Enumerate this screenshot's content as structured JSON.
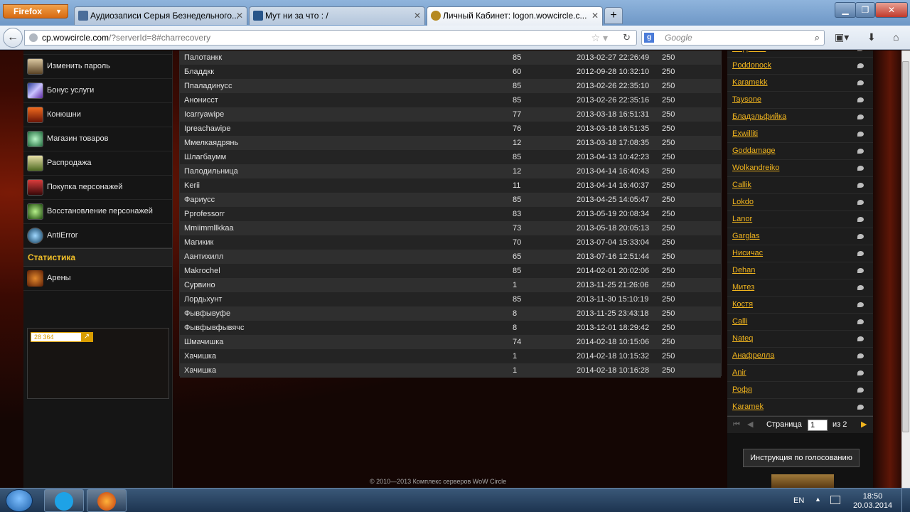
{
  "browser": {
    "menu_label": "Firefox",
    "tabs": [
      {
        "title": "Аудиозаписи Серыя Безнедельного..."
      },
      {
        "title": "Мут ни за что : /"
      },
      {
        "title": "Личный Кабинет: logon.wowcircle.c..."
      }
    ],
    "url_domain": "cp.wowcircle.com",
    "url_path": "/?serverId=8#charrecovery",
    "search_placeholder": "Google"
  },
  "sidebar": {
    "items": [
      {
        "label": "Изменить пароль"
      },
      {
        "label": "Бонус услуги"
      },
      {
        "label": "Конюшни"
      },
      {
        "label": "Магазин товаров"
      },
      {
        "label": "Распродажа"
      },
      {
        "label": "Покупка персонажей"
      },
      {
        "label": "Восстановление персонажей"
      },
      {
        "label": "AntiError"
      }
    ],
    "stats_header": "Статистика",
    "stats_items": [
      {
        "label": "Арены"
      }
    ],
    "counter_value": "28 364"
  },
  "characters": [
    {
      "name": "Палотанкк",
      "level": "85",
      "date": "2013-02-27 22:26:49",
      "cost": "250"
    },
    {
      "name": "Бладдкк",
      "level": "60",
      "date": "2012-09-28 10:32:10",
      "cost": "250"
    },
    {
      "name": "Ппаладинусс",
      "level": "85",
      "date": "2013-02-26 22:35:10",
      "cost": "250"
    },
    {
      "name": "Анонисст",
      "level": "85",
      "date": "2013-02-26 22:35:16",
      "cost": "250"
    },
    {
      "name": "Icarryawipe",
      "level": "77",
      "date": "2013-03-18 16:51:31",
      "cost": "250"
    },
    {
      "name": "Ipreachawipe",
      "level": "76",
      "date": "2013-03-18 16:51:35",
      "cost": "250"
    },
    {
      "name": "Ммелкаядрянь",
      "level": "12",
      "date": "2013-03-18 17:08:35",
      "cost": "250"
    },
    {
      "name": "Шлагбаумм",
      "level": "85",
      "date": "2013-04-13 10:42:23",
      "cost": "250"
    },
    {
      "name": "Палодильница",
      "level": "12",
      "date": "2013-04-14 16:40:43",
      "cost": "250"
    },
    {
      "name": "Kerii",
      "level": "11",
      "date": "2013-04-14 16:40:37",
      "cost": "250"
    },
    {
      "name": "Фариусс",
      "level": "85",
      "date": "2013-04-25 14:05:47",
      "cost": "250"
    },
    {
      "name": "Pprofessorr",
      "level": "83",
      "date": "2013-05-19 20:08:34",
      "cost": "250"
    },
    {
      "name": "Mmiimmllkkaa",
      "level": "73",
      "date": "2013-05-18 20:05:13",
      "cost": "250"
    },
    {
      "name": "Магикик",
      "level": "70",
      "date": "2013-07-04 15:33:04",
      "cost": "250"
    },
    {
      "name": "Аантихилл",
      "level": "65",
      "date": "2013-07-16 12:51:44",
      "cost": "250"
    },
    {
      "name": "Makrochel",
      "level": "85",
      "date": "2014-02-01 20:02:06",
      "cost": "250"
    },
    {
      "name": "Сурвино",
      "level": "1",
      "date": "2013-11-25 21:26:06",
      "cost": "250"
    },
    {
      "name": "Лордьхунт",
      "level": "85",
      "date": "2013-11-30 15:10:19",
      "cost": "250"
    },
    {
      "name": "Фывфывуфе",
      "level": "8",
      "date": "2013-11-25 23:43:18",
      "cost": "250"
    },
    {
      "name": "Фывфывфывячс",
      "level": "8",
      "date": "2013-12-01 18:29:42",
      "cost": "250"
    },
    {
      "name": "Шмачишка",
      "level": "74",
      "date": "2014-02-18 10:15:06",
      "cost": "250"
    },
    {
      "name": "Хачишка",
      "level": "1",
      "date": "2014-02-18 10:15:32",
      "cost": "250"
    },
    {
      "name": "Хачишка",
      "level": "1",
      "date": "2014-02-18 10:16:28",
      "cost": "250"
    }
  ],
  "voters": [
    "Медбежа",
    "Poddonock",
    "Karamekk",
    "Taysone",
    "Бладэльфийка",
    "Exwilliti",
    "Goddamage",
    "Wolkandreiko",
    "Callik",
    "Lokdo",
    "Lanor",
    "Garglas",
    "Нисичас",
    "Dehan",
    "Митез",
    "Костя",
    "Calli",
    "Nateq",
    "Анафрелла",
    "Anir",
    "Рофя",
    "Karamek"
  ],
  "pager": {
    "page_label": "Страница",
    "page_value": "1",
    "of_label": "из 2"
  },
  "howto_button": "Инструкция по голосованию",
  "footer": "© 2010—2013 Комплекс серверов WoW Circle",
  "taskbar": {
    "lang": "EN",
    "time": "18:50",
    "date": "20.03.2014"
  },
  "colors": {
    "accent": "#f0b41e",
    "stats_header": "#f2c028"
  }
}
